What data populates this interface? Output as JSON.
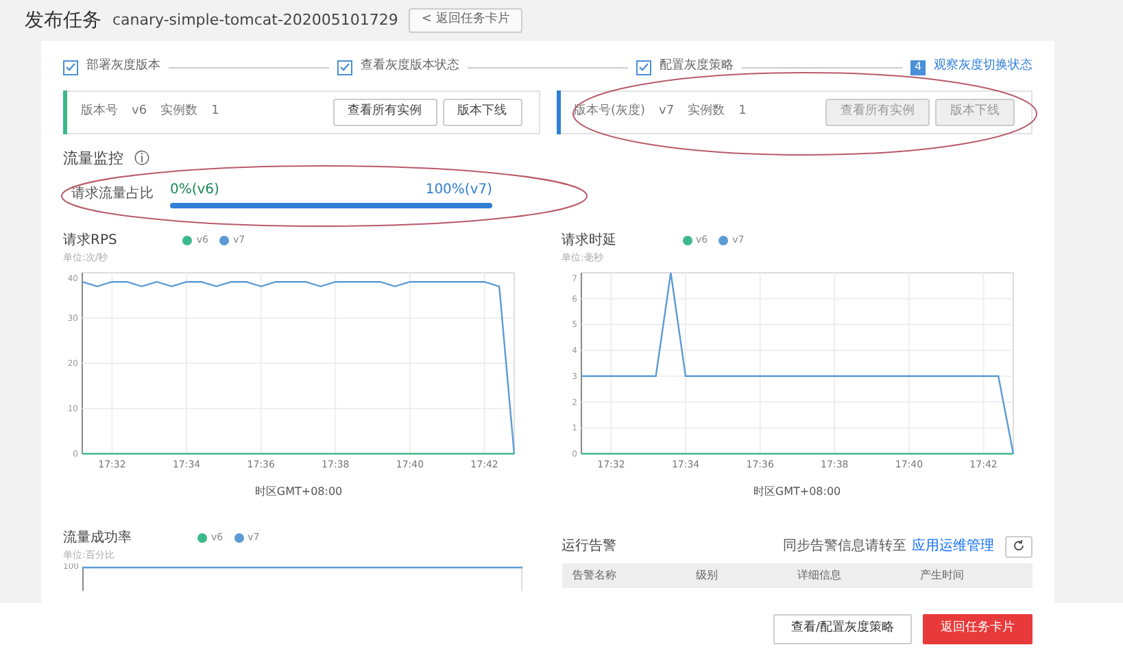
{
  "header": {
    "title": "发布任务",
    "task_name": "canary-simple-tomcat-202005101729",
    "back_button": "< 返回任务卡片"
  },
  "steps": [
    {
      "label": "部署灰度版本",
      "done": true,
      "selected": false
    },
    {
      "label": "查看灰度版本状态",
      "done": true,
      "selected": false
    },
    {
      "label": "配置灰度策略",
      "done": true,
      "selected": false
    },
    {
      "number": "4",
      "label": "观察灰度切换状态",
      "done": false,
      "selected": true
    }
  ],
  "versions": [
    {
      "version_label": "版本号",
      "version": "v6",
      "instances_label": "实例数",
      "instances": "1",
      "buttons": [
        {
          "label": "查看所有实例",
          "disabled": false
        },
        {
          "label": "版本下线",
          "disabled": false
        }
      ],
      "color": "#3db88b",
      "circled": false
    },
    {
      "version_label": "版本号(灰度)",
      "version": "v7",
      "instances_label": "实例数",
      "instances": "1",
      "buttons": [
        {
          "label": "查看所有实例",
          "disabled": true
        },
        {
          "label": "版本下线",
          "disabled": true
        }
      ],
      "color": "#2f7fd6",
      "circled": true
    }
  ],
  "traffic": {
    "title": "流量监控",
    "info_icon": "ⓘ",
    "ratio_label": "请求流量占比",
    "left": "0%(v6)",
    "right": "100%(v7)",
    "level": 1,
    "circled": true
  },
  "charts": [
    {
      "title": "请求RPS",
      "unit": "单位:次/秒",
      "xaxis_title": "时区GMT+08:00",
      "chart_data": {
        "type": "line",
        "grid": true,
        "ylim": [
          0,
          40
        ],
        "yticks": [
          0,
          10,
          20,
          30,
          40
        ],
        "categories": [
          null,
          null,
          "17:32",
          null,
          null,
          null,
          null,
          "17:34",
          null,
          null,
          null,
          null,
          "17:36",
          null,
          null,
          null,
          null,
          "17:38",
          null,
          null,
          null,
          null,
          "17:40",
          null,
          null,
          null,
          null,
          "17:42",
          null,
          null
        ],
        "series": [
          {
            "name": "v6",
            "color": "#3db88b",
            "values": [
              0,
              0,
              0,
              0,
              0,
              0,
              0,
              0,
              0,
              0,
              0,
              0,
              0,
              0,
              0,
              0,
              0,
              0,
              0,
              0,
              0,
              0,
              0,
              0,
              0,
              0,
              0,
              0,
              0,
              0
            ]
          },
          {
            "name": "v7",
            "color": "#5b9bd5",
            "values": [
              38,
              37,
              38,
              38,
              37,
              38,
              37,
              38,
              38,
              37,
              38,
              38,
              37,
              38,
              38,
              38,
              37,
              38,
              38,
              38,
              38,
              37,
              38,
              38,
              38,
              38,
              38,
              38,
              37,
              0
            ]
          }
        ]
      }
    },
    {
      "title": "请求时延",
      "unit": "单位:毫秒",
      "xaxis_title": "时区GMT+08:00",
      "chart_data": {
        "type": "line",
        "grid": true,
        "ylim": [
          0,
          7
        ],
        "yticks": [
          0,
          1,
          2,
          3,
          4,
          5,
          6,
          7
        ],
        "categories": [
          null,
          null,
          "17:32",
          null,
          null,
          null,
          null,
          "17:34",
          null,
          null,
          null,
          null,
          "17:36",
          null,
          null,
          null,
          null,
          "17:38",
          null,
          null,
          null,
          null,
          "17:40",
          null,
          null,
          null,
          null,
          "17:42",
          null,
          null
        ],
        "series": [
          {
            "name": "v6",
            "color": "#3db88b",
            "values": [
              0,
              0,
              0,
              0,
              0,
              0,
              0,
              0,
              0,
              0,
              0,
              0,
              0,
              0,
              0,
              0,
              0,
              0,
              0,
              0,
              0,
              0,
              0,
              0,
              0,
              0,
              0,
              0,
              0,
              0
            ]
          },
          {
            "name": "v7",
            "color": "#5b9bd5",
            "values": [
              3,
              3,
              3,
              3,
              3,
              3,
              7,
              3,
              3,
              3,
              3,
              3,
              3,
              3,
              3,
              3,
              3,
              3,
              3,
              3,
              3,
              3,
              3,
              3,
              3,
              3,
              3,
              3,
              3,
              0
            ]
          }
        ]
      }
    },
    {
      "title": "流量成功率",
      "unit": "单位:百分比",
      "legend": [
        {
          "name": "v6",
          "color": "#3db88b"
        },
        {
          "name": "v7",
          "color": "#5b9bd5"
        }
      ],
      "axis_label": "100"
    }
  ],
  "alarms": {
    "title": "运行告警",
    "note": "同步告警信息请转至",
    "link": "应用运维管理",
    "columns": [
      "告警名称",
      "级别",
      "详细信息",
      "产生时间"
    ]
  },
  "footer_buttons": [
    {
      "label": "查看/配置灰度策略",
      "kind": "secondary"
    },
    {
      "label": "返回任务卡片",
      "kind": "danger"
    }
  ]
}
